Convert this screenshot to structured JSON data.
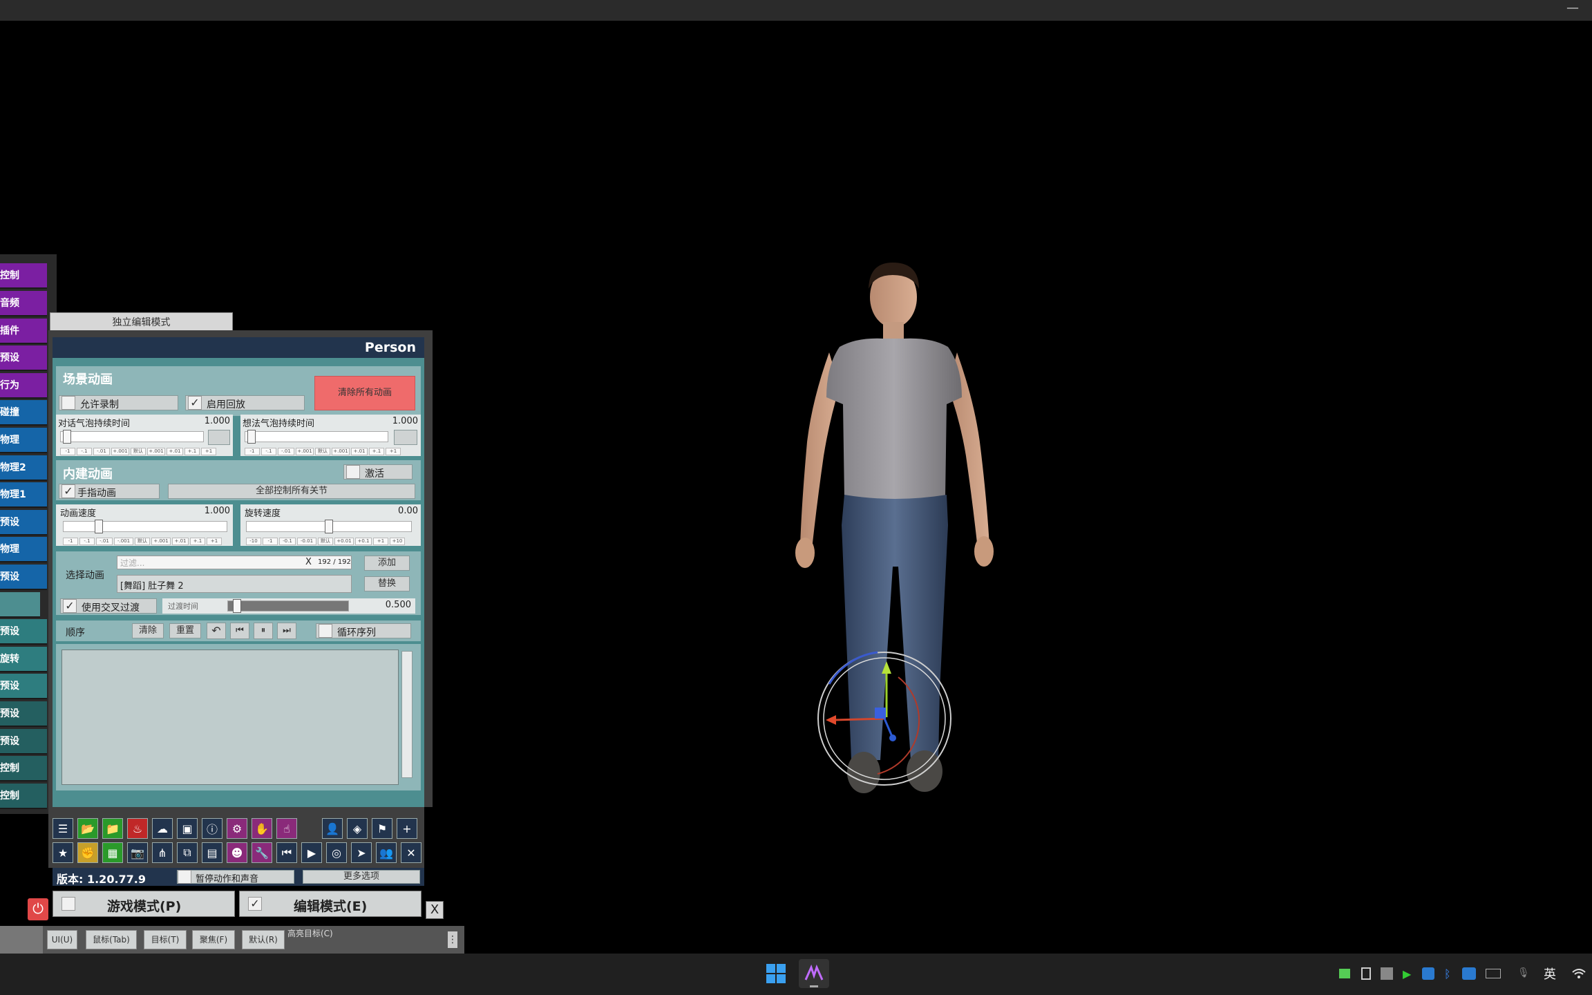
{
  "app": {
    "minimize_label": "—"
  },
  "sidebar": {
    "items": [
      {
        "label": "控制",
        "color": "#7b1fa2"
      },
      {
        "label": "音频",
        "color": "#7b1fa2"
      },
      {
        "label": "插件",
        "color": "#7b1fa2"
      },
      {
        "label": "预设",
        "color": "#7b1fa2"
      },
      {
        "label": "行为",
        "color": "#7b1fa2"
      },
      {
        "label": "碰撞",
        "color": "#1565a8"
      },
      {
        "label": "物理",
        "color": "#1565a8"
      },
      {
        "label": "物理2",
        "color": "#1565a8"
      },
      {
        "label": "物理1",
        "color": "#1565a8"
      },
      {
        "label": "预设",
        "color": "#1565a8"
      },
      {
        "label": "物理",
        "color": "#1565a8"
      },
      {
        "label": "预设",
        "color": "#1565a8"
      },
      {
        "label": "",
        "color": "#4d8e90"
      },
      {
        "label": "预设",
        "color": "#2e7d7f"
      },
      {
        "label": "旋转",
        "color": "#2e7d7f"
      },
      {
        "label": "预设",
        "color": "#2e7d7f"
      },
      {
        "label": "预设",
        "color": "#245f60"
      },
      {
        "label": "预设",
        "color": "#245f60"
      },
      {
        "label": "控制",
        "color": "#245f60"
      },
      {
        "label": "控制",
        "color": "#245f60"
      }
    ]
  },
  "panel": {
    "independent_edit": "独立编辑模式",
    "title": "Person",
    "scene_anim": {
      "heading": "场景动画",
      "allow_record": "允许录制",
      "allow_record_checked": false,
      "enable_playback": "启用回放",
      "enable_playback_checked": true,
      "clear_all": "清除所有动画"
    },
    "bubbles": {
      "speech_label": "对话气泡持续时间",
      "speech_value": "1.000",
      "thought_label": "想法气泡持续时间",
      "thought_value": "1.000",
      "tiny_left": [
        "-1",
        "-.1",
        "-.01",
        "+.001",
        "默认",
        "+.001",
        "+.01",
        "+.1",
        "+1"
      ],
      "tiny_right": [
        "-1",
        "-.1",
        "-.01",
        "+.001",
        "默认",
        "+.001",
        "+.01",
        "+.1",
        "+1"
      ]
    },
    "builtin": {
      "heading": "内建动画",
      "activate": "激活",
      "activate_checked": false,
      "hand_anim": "手指动画",
      "hand_anim_checked": true,
      "control_all": "全部控制所有关节",
      "speed_label": "动画速度",
      "speed_value": "1.000",
      "rot_label": "旋转速度",
      "rot_value": "0.00",
      "tiny_speed": [
        "-1",
        "-.1",
        "-.01",
        "-.001",
        "默认",
        "+.001",
        "+.01",
        "+.1",
        "+1"
      ],
      "tiny_rot": [
        "-10",
        "-1",
        "-0.1",
        "-0.01",
        "默认",
        "+0.01",
        "+0.1",
        "+1",
        "+10"
      ]
    },
    "select": {
      "label": "选择动画",
      "filter_placeholder": "过滤...",
      "clear_x": "X",
      "count": "192 / 192",
      "add": "添加",
      "current": "[舞蹈] 肚子舞 2",
      "replace": "替换",
      "use_crossfade": "使用交叉过渡",
      "use_crossfade_checked": true,
      "fade_label": "过渡时间",
      "fade_value": "0.500",
      "fade_fraction": 0.05
    },
    "sequence": {
      "label": "顺序",
      "clear": "清除",
      "reset": "重置",
      "loop": "循环序列",
      "loop_checked": false
    },
    "version": "版本: 1.20.77.9",
    "pause_anim_sound": "暂停动作和声音",
    "more_options": "更多选项",
    "play_mode": "游戏模式(P)",
    "play_mode_checked": false,
    "edit_mode": "编辑模式(E)",
    "edit_mode_checked": true,
    "close_x": "X"
  },
  "toolbar": {
    "row1": [
      "menu-icon",
      "folder-open-icon",
      "folder-icon",
      "fire-icon",
      "cloud-icon",
      "box-icon",
      "info-icon",
      "person-settings-icon",
      "hand-icon",
      "pointer-hand-icon",
      "spacer",
      "person-icon",
      "unity-icon",
      "flag-icon",
      "plus-icon"
    ],
    "row2": [
      "star-icon",
      "hand-grab-icon",
      "screenshot-icon",
      "camera-icon",
      "nodes-icon",
      "package-icon",
      "document-icon",
      "person-add-icon",
      "wrench-icon",
      "step-back-icon",
      "play-icon",
      "target-icon",
      "cursor-icon",
      "people-icon",
      "tools-icon"
    ]
  },
  "hotkeys": {
    "items": [
      "UI(U)",
      "鼠标(Tab)",
      "目标(T)",
      "聚焦(F)",
      "默认(R)"
    ],
    "highlight": "高亮目标(C)"
  },
  "taskbar": {
    "ime": "英"
  }
}
